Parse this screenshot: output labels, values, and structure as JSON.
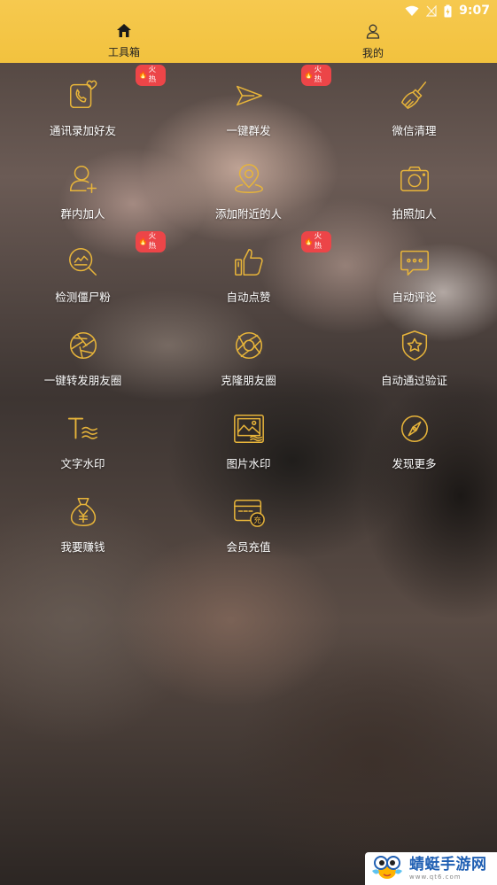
{
  "status_bar": {
    "time": "9:07",
    "icons": [
      "wifi-icon",
      "no-signal-icon",
      "battery-charging-icon"
    ]
  },
  "nav": {
    "tabs": [
      {
        "label": "工具箱",
        "icon": "home-icon",
        "active": true
      },
      {
        "label": "我的",
        "icon": "person-icon",
        "active": false
      }
    ]
  },
  "hot_badge_label": "火热",
  "tools": [
    {
      "label": "通讯录加好友",
      "icon": "contacts-phone-heart-icon",
      "hot": true
    },
    {
      "label": "一键群发",
      "icon": "send-plane-icon",
      "hot": true
    },
    {
      "label": "微信清理",
      "icon": "broom-icon",
      "hot": false
    },
    {
      "label": "群内加人",
      "icon": "add-person-icon",
      "hot": false
    },
    {
      "label": "添加附近的人",
      "icon": "location-pin-icon",
      "hot": false
    },
    {
      "label": "拍照加人",
      "icon": "camera-icon",
      "hot": false
    },
    {
      "label": "检测僵尸粉",
      "icon": "magnifier-detect-icon",
      "hot": true
    },
    {
      "label": "自动点赞",
      "icon": "thumbs-up-icon",
      "hot": true
    },
    {
      "label": "自动评论",
      "icon": "comment-bubble-icon",
      "hot": false
    },
    {
      "label": "一键转发朋友圈",
      "icon": "moments-aperture-icon",
      "hot": false
    },
    {
      "label": "克隆朋友圈",
      "icon": "clone-aperture-icon",
      "hot": false
    },
    {
      "label": "自动通过验证",
      "icon": "shield-star-icon",
      "hot": false
    },
    {
      "label": "文字水印",
      "icon": "text-watermark-icon",
      "hot": false
    },
    {
      "label": "图片水印",
      "icon": "image-watermark-icon",
      "hot": false
    },
    {
      "label": "发现更多",
      "icon": "compass-icon",
      "hot": false
    },
    {
      "label": "我要赚钱",
      "icon": "money-bag-icon",
      "hot": false
    },
    {
      "label": "会员充值",
      "icon": "recharge-card-icon",
      "hot": false
    }
  ],
  "watermark": {
    "main": "蜻蜓手游网",
    "sub": "www.qt6.com"
  },
  "colors": {
    "header": "#f2c23e",
    "icon_stroke": "#e7b43a",
    "hot_badge": "#ec4548"
  }
}
